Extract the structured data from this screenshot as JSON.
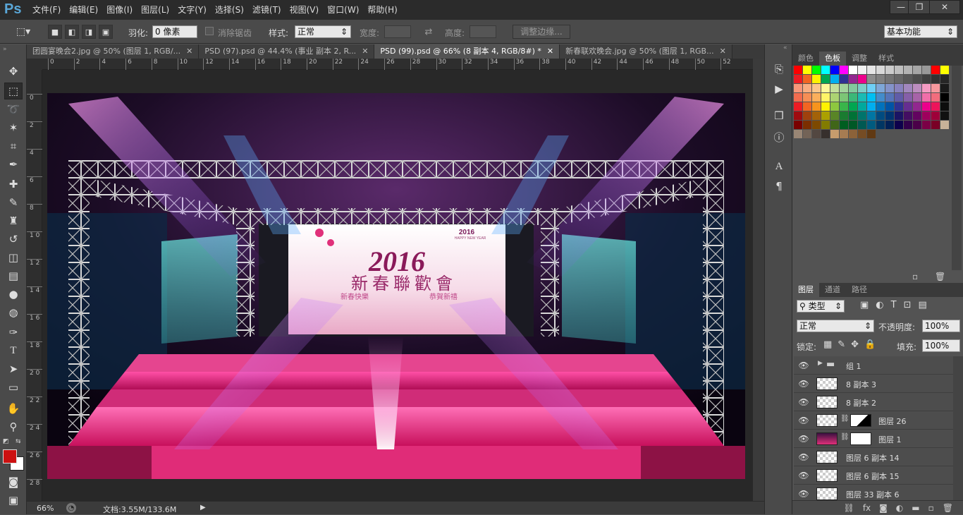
{
  "app": {
    "logo": "Ps"
  },
  "menu": [
    "文件(F)",
    "编辑(E)",
    "图像(I)",
    "图层(L)",
    "文字(Y)",
    "选择(S)",
    "滤镜(T)",
    "视图(V)",
    "窗口(W)",
    "帮助(H)"
  ],
  "window_controls": {
    "minimize": "—",
    "restore": "❐",
    "close": "✕"
  },
  "options": {
    "feather_label": "羽化:",
    "feather_value": "0 像素",
    "antialias_label": "消除锯齿",
    "style_label": "样式:",
    "style_value": "正常",
    "width_label": "宽度:",
    "height_label": "高度:",
    "refine_edge": "调整边缘...",
    "workspace": "基本功能"
  },
  "tabs": [
    {
      "label": "团圆宴晚会2.jpg @ 50% (图层 1, RGB/...",
      "active": false
    },
    {
      "label": "PSD (97).psd @ 44.4% (事业 副本 2, R...",
      "active": false
    },
    {
      "label": "PSD (99).psd @ 66% (8 副本 4, RGB/8#) *",
      "active": true
    },
    {
      "label": "新春联欢晚会.jpg @ 50% (图层 1, RGB...",
      "active": false
    }
  ],
  "ruler_h": [
    "0",
    "2",
    "4",
    "6",
    "8",
    "10",
    "12",
    "14",
    "16",
    "18",
    "20",
    "22",
    "24",
    "26",
    "28",
    "30",
    "32",
    "34",
    "36",
    "38",
    "40",
    "42",
    "44",
    "46",
    "48",
    "50",
    "52"
  ],
  "ruler_v": [
    "0",
    "2",
    "4",
    "6",
    "8",
    "1 0",
    "1 2",
    "1 4",
    "1 6",
    "1 8",
    "2 0",
    "2 2",
    "2 4",
    "2 6",
    "2 8"
  ],
  "artwork": {
    "year": "2016",
    "title": "新春聯歡會",
    "subtitle_left": "新春快樂",
    "subtitle_right": "恭賀新禧",
    "banner_small": "2016",
    "banner_tag": "HAPPY NEW YEAR"
  },
  "status": {
    "zoom": "66%",
    "doc": "文档:3.55M/133.6M"
  },
  "swatch_tabs": [
    "颜色",
    "色板",
    "调整",
    "样式"
  ],
  "swatch_active": "色板",
  "swatches": [
    "#ff0000",
    "#ffff00",
    "#00ff00",
    "#00ffff",
    "#0000ff",
    "#ff00ff",
    "#ffffff",
    "#f2f2f2",
    "#e6e6e6",
    "#d9d9d9",
    "#cccccc",
    "#bfbfbf",
    "#b3b3b3",
    "#a6a6a6",
    "#999999",
    "#ff0000",
    "#ffff00",
    "#ed1c24",
    "#f26522",
    "#fff200",
    "#00a651",
    "#00aeef",
    "#2e3192",
    "#92278f",
    "#ec008c",
    "#8c8c8c",
    "#808080",
    "#737373",
    "#666666",
    "#595959",
    "#4d4d4d",
    "#404040",
    "#333333",
    "#262626",
    "#f7977a",
    "#f9ad81",
    "#fdc68a",
    "#fff79a",
    "#c4df9b",
    "#a2d39c",
    "#82ca9d",
    "#7bcdc8",
    "#6ecff6",
    "#7ea7d8",
    "#8493ca",
    "#8882be",
    "#a187be",
    "#bc8dbf",
    "#f49ac2",
    "#f6989d",
    "#1a1a1a",
    "#f26c4f",
    "#f68e55",
    "#fbaf5c",
    "#fff467",
    "#acd372",
    "#7cc576",
    "#3bb878",
    "#1abbb4",
    "#00bff3",
    "#438ccb",
    "#5574b9",
    "#605ca8",
    "#855fa8",
    "#a763a8",
    "#f06ea9",
    "#f26d7d",
    "#000000",
    "#ed1c24",
    "#f26522",
    "#f7941d",
    "#fff200",
    "#8dc73f",
    "#39b54a",
    "#00a651",
    "#00a99d",
    "#00aeef",
    "#0072bc",
    "#0054a6",
    "#2e3192",
    "#662d91",
    "#92278f",
    "#ec008c",
    "#ed145b",
    "#0d0d0d",
    "#9e0b0f",
    "#a0410d",
    "#a36209",
    "#aba000",
    "#598527",
    "#1a7b30",
    "#007236",
    "#00746b",
    "#0076a3",
    "#004b80",
    "#003471",
    "#1b1464",
    "#440e62",
    "#630460",
    "#9e005d",
    "#9e0039",
    "#111111",
    "#790000",
    "#7b2e00",
    "#7d4900",
    "#827b00",
    "#406618",
    "#005e20",
    "#005826",
    "#005952",
    "#005b7f",
    "#003663",
    "#002157",
    "#0d004c",
    "#32004b",
    "#4b0049",
    "#7b0046",
    "#7a0026",
    "#c7b299",
    "#998675",
    "#736357",
    "#534741",
    "#37302d",
    "#c69c6d",
    "#a67c52",
    "#8c6239",
    "#754c24",
    "#603913"
  ],
  "layers_panel": {
    "tabs": [
      "图层",
      "通道",
      "路径"
    ],
    "filter": "类型",
    "blend": "正常",
    "opacity_label": "不透明度:",
    "opacity": "100%",
    "lock_label": "锁定:",
    "fill_label": "填充:",
    "fill": "100%",
    "layers": [
      {
        "name": "组 1",
        "kind": "group"
      },
      {
        "name": "8 副本 3",
        "kind": "layer"
      },
      {
        "name": "8 副本 2",
        "kind": "layer"
      },
      {
        "name": "图层 26",
        "kind": "masked"
      },
      {
        "name": "图层 1",
        "kind": "masked"
      },
      {
        "name": "图层 6 副本 14",
        "kind": "layer"
      },
      {
        "name": "图层 6 副本 15",
        "kind": "layer"
      },
      {
        "name": "图层 33 副本 6",
        "kind": "layer"
      }
    ]
  },
  "colors": {
    "foreground": "#cc1111",
    "background": "#ffffff",
    "accent": "#5aa7d8"
  }
}
